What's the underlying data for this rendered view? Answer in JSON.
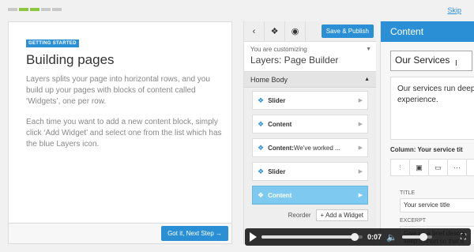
{
  "tour": {
    "progress": {
      "total": 5,
      "current": 2
    },
    "skip_label": "Skip",
    "badge": "GETTING STARTED",
    "title": "Building pages",
    "paragraph1": "Layers splits your page into horizontal rows, and you build up your pages with blocks of content called ‘Widgets’, one per row.",
    "paragraph2": "Each time you want to add a new content block, simply click ‘Add Widget’ and select one from the list which has the blue Layers icon.",
    "next_label": "Got it, Next Step →"
  },
  "customizer": {
    "toolbar": {
      "back_icon": "‹",
      "layers_icon": "❖",
      "preview_icon": "◉",
      "save_label": "Save & Publish"
    },
    "subtitle": "You are customizing",
    "title": "Layers: Page Builder",
    "section_label": "Home Body",
    "widgets": [
      {
        "name": "Slider",
        "extra": ""
      },
      {
        "name": "Content",
        "extra": ""
      },
      {
        "name": "Content:",
        "extra": " We've worked ..."
      },
      {
        "name": "Slider",
        "extra": ""
      },
      {
        "name": "Content",
        "extra": ""
      }
    ],
    "reorder_label": "Reorder",
    "add_widget_label": "+ Add a Widget"
  },
  "content_panel": {
    "header": "Content",
    "title_value": "Our Services",
    "description": "Our services run deep\nexperience.",
    "column_label": "Column: Your service tit",
    "icons": [
      "sliders-icon",
      "image-icon",
      "video-icon",
      "more-icon"
    ],
    "field_title_label": "TITLE",
    "field_title_value": "Your service title",
    "field_excerpt_label": "EXCERPT",
    "field_excerpt_value": "Give us a brief descrip\nkeep it short so that it"
  },
  "player": {
    "time": "0:07",
    "progress_fraction": 0.92,
    "volume_fraction": 0.72
  },
  "colors": {
    "accent": "#2a8fd4",
    "progress_on": "#8cc63f",
    "active_widget": "#7ec9ef"
  }
}
